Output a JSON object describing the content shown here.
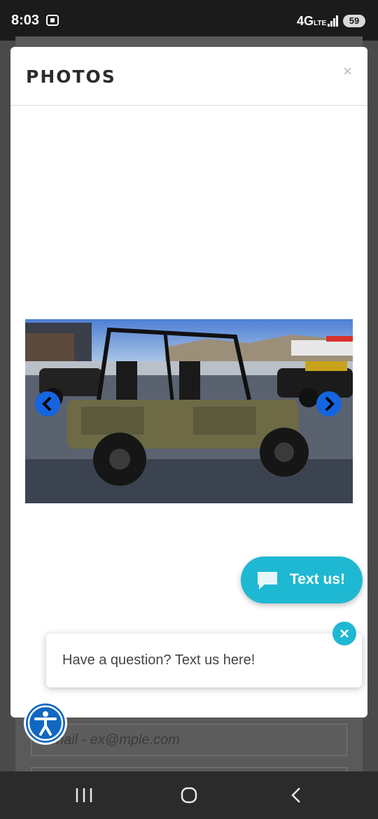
{
  "status_bar": {
    "time": "8:03",
    "network": "4G",
    "network_sub": "LTE",
    "battery": "59"
  },
  "background_form": {
    "email_placeholder": "Email - ex@mple.com"
  },
  "modal": {
    "title": "PHOTOS",
    "close_label": "×"
  },
  "chat_widget": {
    "button_label": "Text us!",
    "prompt_text": "Have a question? Text us here!",
    "accent_color": "#1fb8d2"
  },
  "icons": {
    "prev": "chevron-left-icon",
    "next": "chevron-right-icon",
    "chat": "chat-bubble-icon",
    "accessibility": "accessibility-icon"
  }
}
